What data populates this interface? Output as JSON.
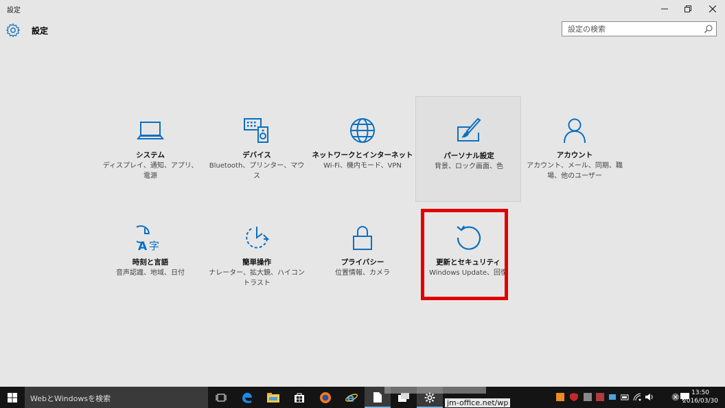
{
  "window": {
    "title": "設定",
    "controls": [
      "minimize",
      "restore",
      "close"
    ]
  },
  "header": {
    "title": "設定",
    "icon": "gear-icon"
  },
  "search": {
    "placeholder": "設定の検索",
    "icon": "search-icon"
  },
  "tiles": [
    {
      "id": "system",
      "icon": "laptop-icon",
      "name": "システム",
      "desc": "ディスプレイ、通知、アプリ、電源"
    },
    {
      "id": "devices",
      "icon": "keyboard-speaker-icon",
      "name": "デバイス",
      "desc": "Bluetooth、プリンター、マウス"
    },
    {
      "id": "network",
      "icon": "globe-icon",
      "name": "ネットワークとインターネット",
      "desc": "Wi-Fi、機内モード、VPN"
    },
    {
      "id": "personalization",
      "icon": "paint-brush-icon",
      "name": "パーソナル設定",
      "desc": "背景、ロック画面、色"
    },
    {
      "id": "accounts",
      "icon": "person-icon",
      "name": "アカウント",
      "desc": "アカウント、メール、同期、職場、他のユーザー"
    },
    {
      "id": "time-language",
      "icon": "clock-language-icon",
      "name": "時刻と言語",
      "desc": "音声認識、地域、日付"
    },
    {
      "id": "ease-of-access",
      "icon": "ease-of-access-icon",
      "name": "簡単操作",
      "desc": "ナレーター、拡大鏡、ハイコントラスト"
    },
    {
      "id": "privacy",
      "icon": "lock-icon",
      "name": "プライバシー",
      "desc": "位置情報、カメラ"
    },
    {
      "id": "update-security",
      "icon": "refresh-icon",
      "name": "更新とセキュリティ",
      "desc": "Windows Update、回復"
    }
  ],
  "colors": {
    "accent": "#0a6fc2",
    "highlight_box": "#e00000",
    "background": "#e6e6e6"
  },
  "taskbar": {
    "search_text": "WebとWindowsを検索",
    "peek_text": "jm-office.net/wp",
    "clock_time": "13:50",
    "clock_date": "2016/03/30"
  }
}
